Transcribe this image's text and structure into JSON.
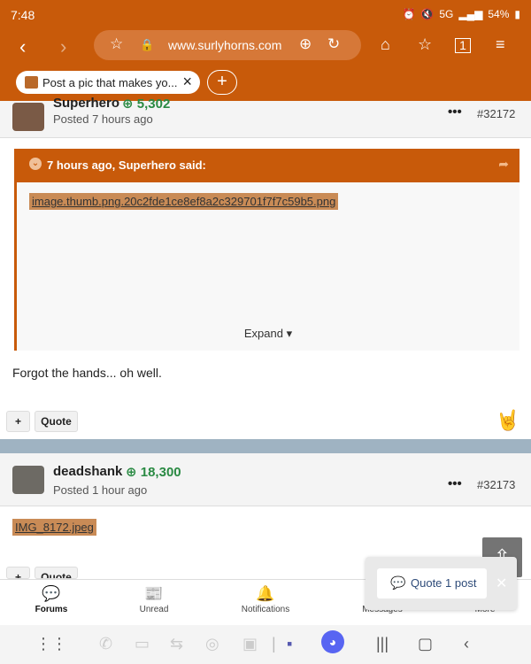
{
  "status_bar": {
    "time": "7:48",
    "network": "5G",
    "battery": "54%"
  },
  "browser": {
    "url": "www.surlyhorns.com",
    "tab_title": "Post a pic that makes yo...",
    "tab_count": "1"
  },
  "post1": {
    "author": "Superhero",
    "reputation": "5,302",
    "posted": "Posted 7 hours ago",
    "number": "#32172",
    "quote_header": "7 hours ago, Superhero said:",
    "image_link": "image.thumb.png.20c2fde1ce8ef8a2c329701f7f7c59b5.png",
    "expand": "Expand",
    "text": "Forgot the hands... oh well."
  },
  "post2": {
    "author": "deadshank",
    "reputation": "18,300",
    "posted": "Posted 1 hour ago",
    "number": "#32173",
    "image_link": "IMG_8172.jpeg"
  },
  "buttons": {
    "plus": "+",
    "quote": "Quote"
  },
  "popup": {
    "label": "Quote 1 post"
  },
  "bottom_nav": {
    "forums": "Forums",
    "unread": "Unread",
    "notifications": "Notifications",
    "messages": "Messages",
    "more": "More"
  },
  "colors": {
    "brand": "#c85a0a",
    "reputation": "#2a8a43"
  }
}
